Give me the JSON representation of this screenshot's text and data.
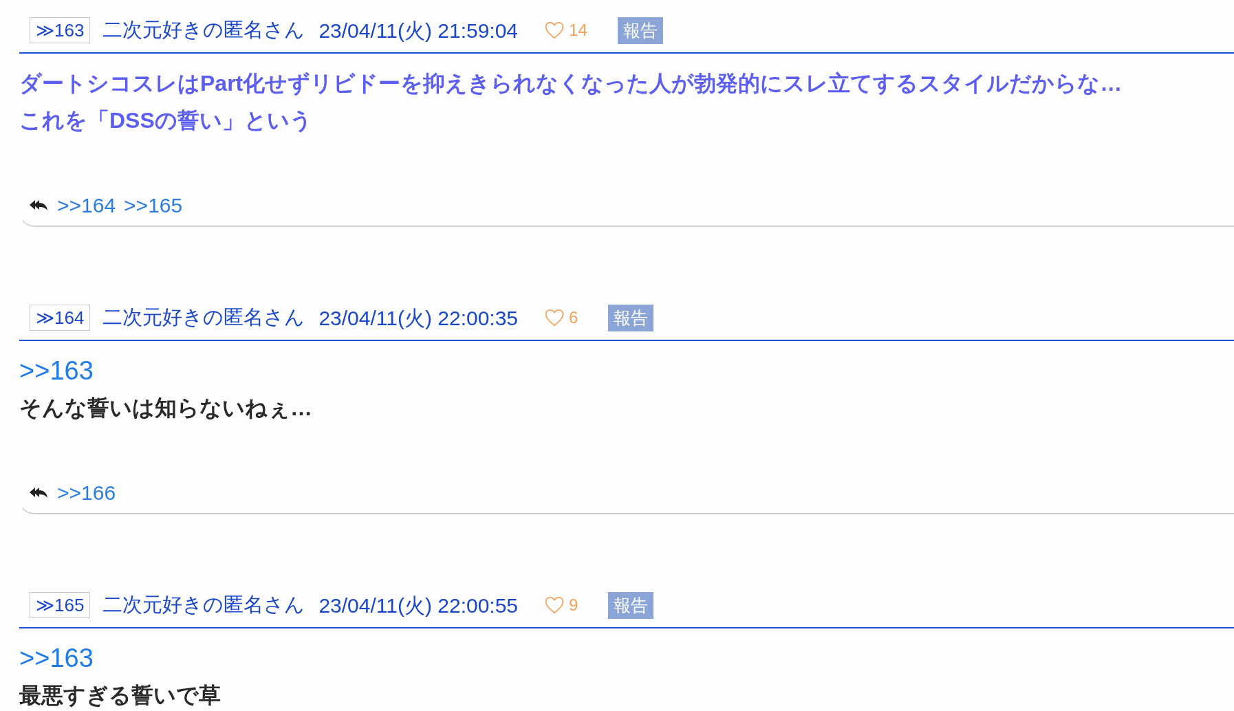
{
  "posts": [
    {
      "number": "≫163",
      "name": "二次元好きの匿名さん",
      "date": "23/04/11(火) 21:59:04",
      "likes": "14",
      "report": "報告",
      "body": {
        "kind": "colored",
        "color": "#5b5ef0",
        "text": "ダートシコスレはPart化せずリビドーを抑えきられなくなった人が勃発的にスレ立てするスタイルだからな…\nこれを「DSSの誓い」という"
      },
      "replies": [
        ">>164",
        ">>165"
      ]
    },
    {
      "number": "≫164",
      "name": "二次元好きの匿名さん",
      "date": "23/04/11(火) 22:00:35",
      "likes": "6",
      "report": "報告",
      "body": {
        "kind": "plain",
        "anchor": ">>163",
        "text": "そんな誓いは知らないねぇ…"
      },
      "replies": [
        ">>166"
      ]
    },
    {
      "number": "≫165",
      "name": "二次元好きの匿名さん",
      "date": "23/04/11(火) 22:00:55",
      "likes": "9",
      "report": "報告",
      "body": {
        "kind": "plain",
        "anchor": ">>163",
        "text": "最悪すぎる誓いで草"
      }
    }
  ]
}
